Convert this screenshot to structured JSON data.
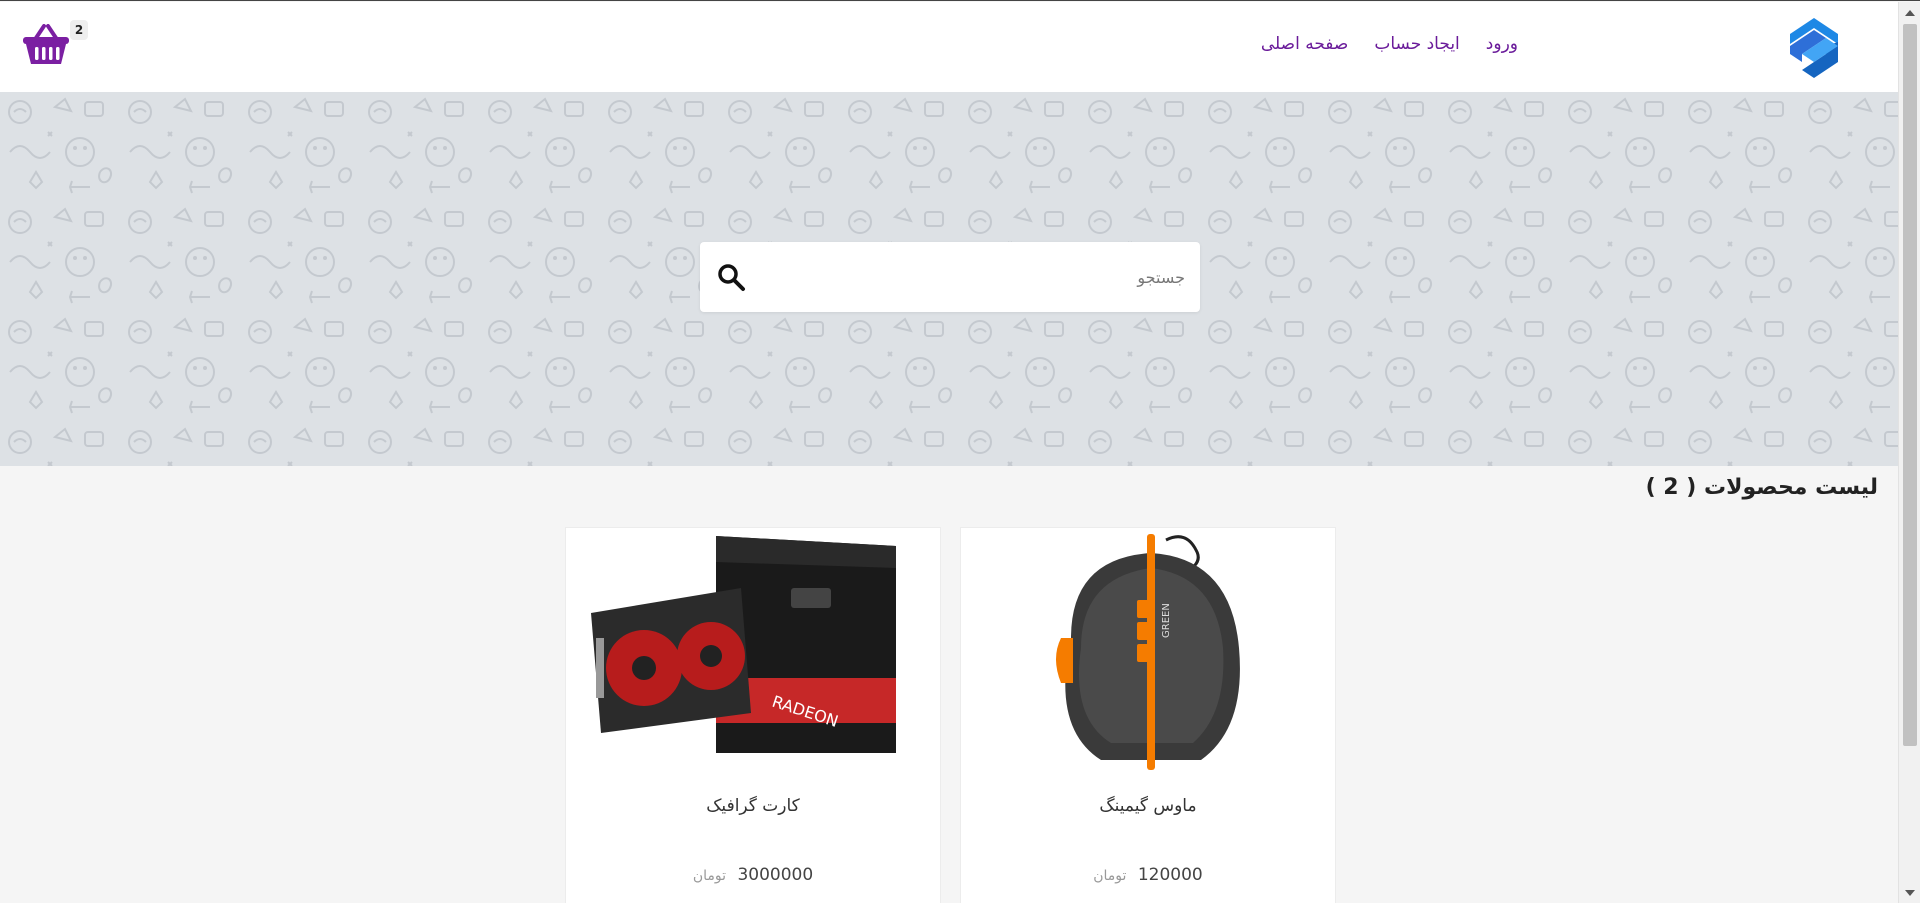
{
  "header": {
    "nav": [
      {
        "label": "صفحه اصلی",
        "name": "nav-home"
      },
      {
        "label": "ایجاد حساب",
        "name": "nav-register"
      },
      {
        "label": "ورود",
        "name": "nav-login"
      }
    ],
    "cart_count": "2"
  },
  "search": {
    "placeholder": "جستجو"
  },
  "products": {
    "title": "لیست محصولات ( 2 )",
    "items": [
      {
        "name": "ماوس گیمینگ",
        "price": "120000",
        "currency": "تومان",
        "image": "gaming-mouse"
      },
      {
        "name": "کارت گرافیک",
        "price": "3000000",
        "currency": "تومان",
        "image": "graphics-card"
      }
    ]
  },
  "colors": {
    "accent": "#7b1fa2",
    "nav_text": "#6a1b9a",
    "hero_bg": "#dde1e5",
    "logo_blue": "#2e6fd8"
  },
  "icons": [
    "logo-icon",
    "basket-icon",
    "search-icon"
  ]
}
